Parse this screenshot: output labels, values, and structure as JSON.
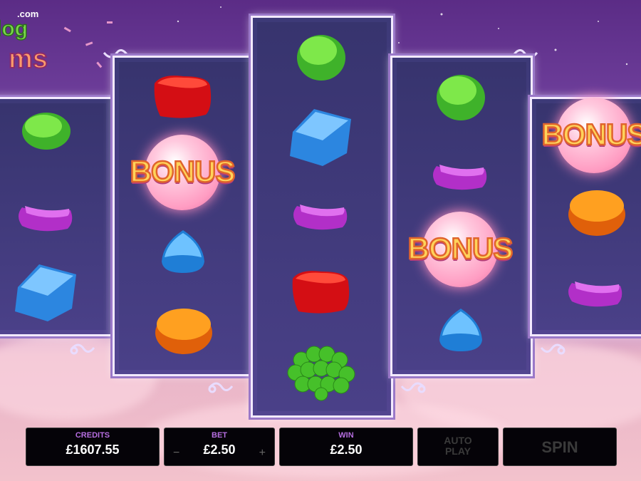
{
  "logo": {
    "top_text": ".com",
    "word1": "log",
    "word2": "ms"
  },
  "reels": {
    "bonus_label": "BONUS"
  },
  "controls": {
    "credits_label": "CREDITS",
    "credits_value": "£1607.55",
    "bet_label": "BET",
    "bet_value": "£2.50",
    "bet_minus": "−",
    "bet_plus": "+",
    "win_label": "WIN",
    "win_value": "£2.50",
    "autoplay_label": "AUTO\nPLAY",
    "spin_label": "SPIN"
  },
  "colors": {
    "accent": "#b66ee0",
    "panel": "#050308"
  }
}
